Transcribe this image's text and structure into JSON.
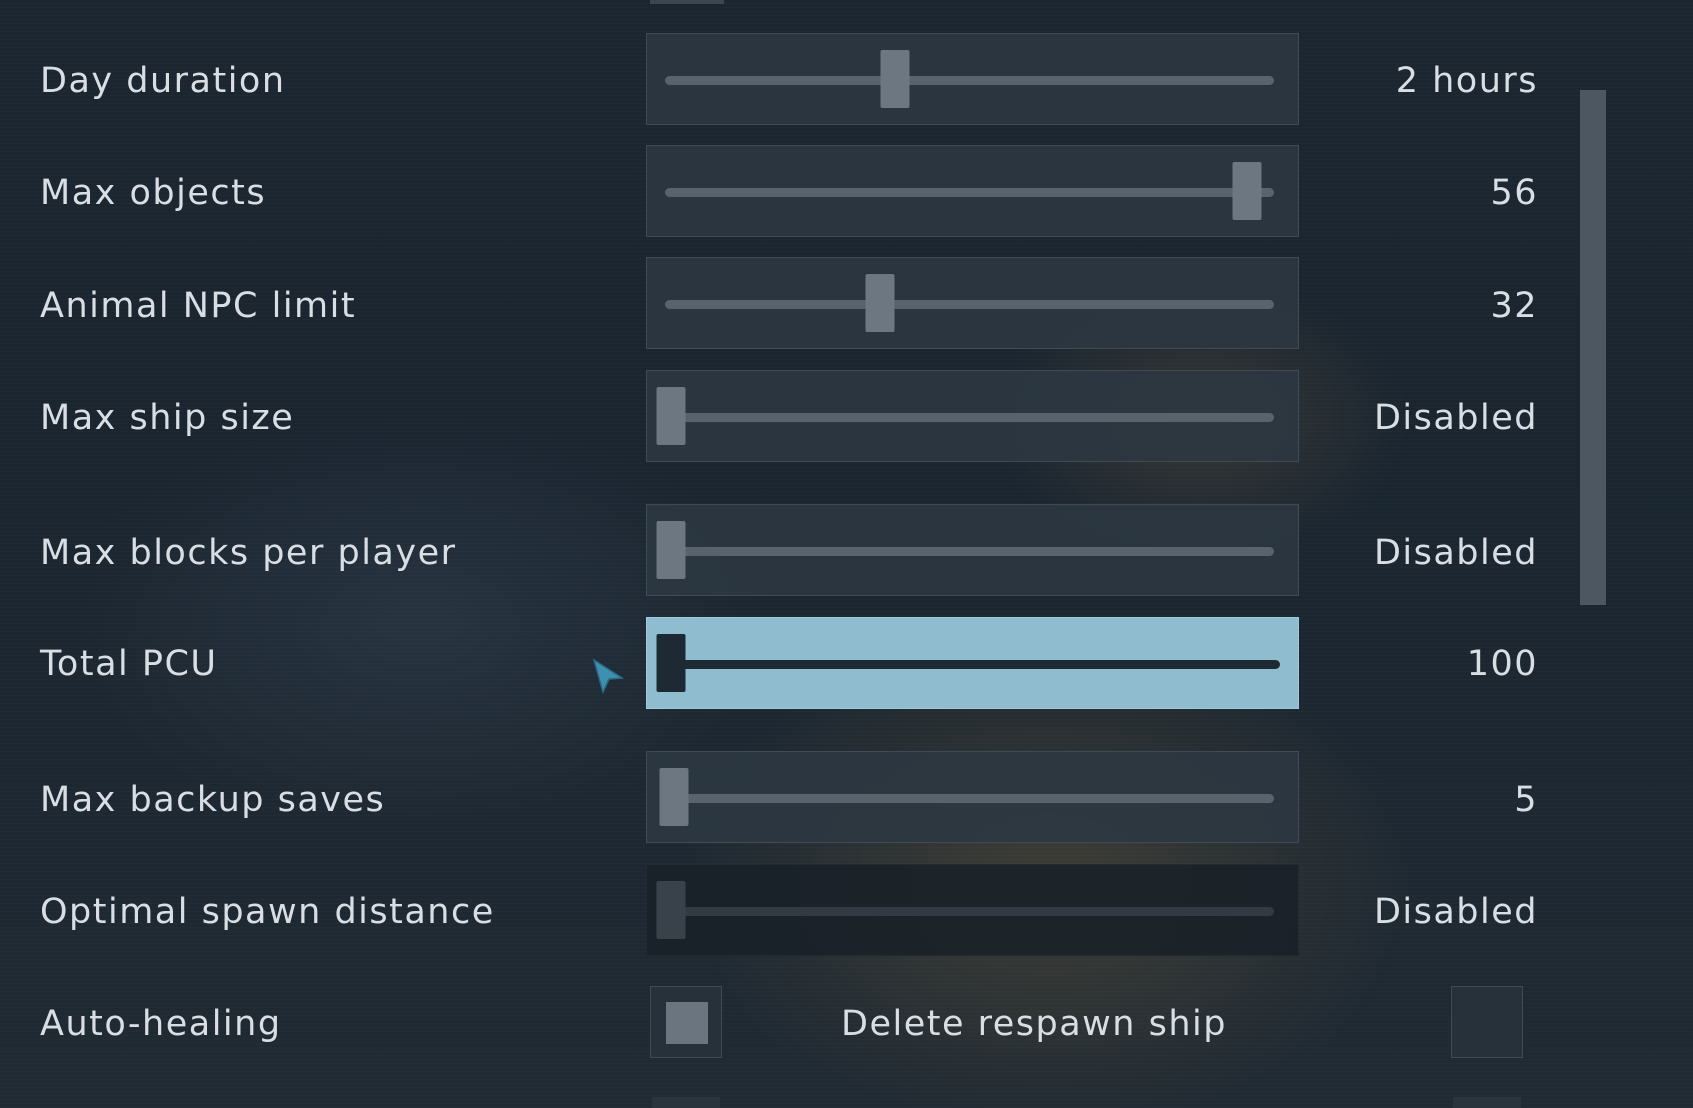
{
  "settings": {
    "day_duration": {
      "label": "Day duration",
      "value": "2 hours",
      "position": 0.375
    },
    "max_objects": {
      "label": "Max objects",
      "value": "56",
      "position": 0.965
    },
    "animal_npc_limit": {
      "label": "Animal NPC limit",
      "value": "32",
      "position": 0.35
    },
    "max_ship_size": {
      "label": "Max ship size",
      "value": "Disabled",
      "position": 0.0
    },
    "max_blocks_per_player": {
      "label": "Max blocks per player",
      "value": "Disabled",
      "position": 0.0
    },
    "total_pcu": {
      "label": "Total PCU",
      "value": "100",
      "position": 0.0
    },
    "max_backup_saves": {
      "label": "Max backup saves",
      "value": "5",
      "position": 0.005
    },
    "optimal_spawn_distance": {
      "label": "Optimal spawn distance",
      "value": "Disabled",
      "position": 0.0
    },
    "auto_healing": {
      "label": "Auto-healing",
      "checked": true
    },
    "delete_respawn_ship": {
      "label": "Delete respawn ship",
      "checked": false
    }
  },
  "colors": {
    "focused_slider": "#8fbccf",
    "cursor": "#3f8fb0"
  }
}
